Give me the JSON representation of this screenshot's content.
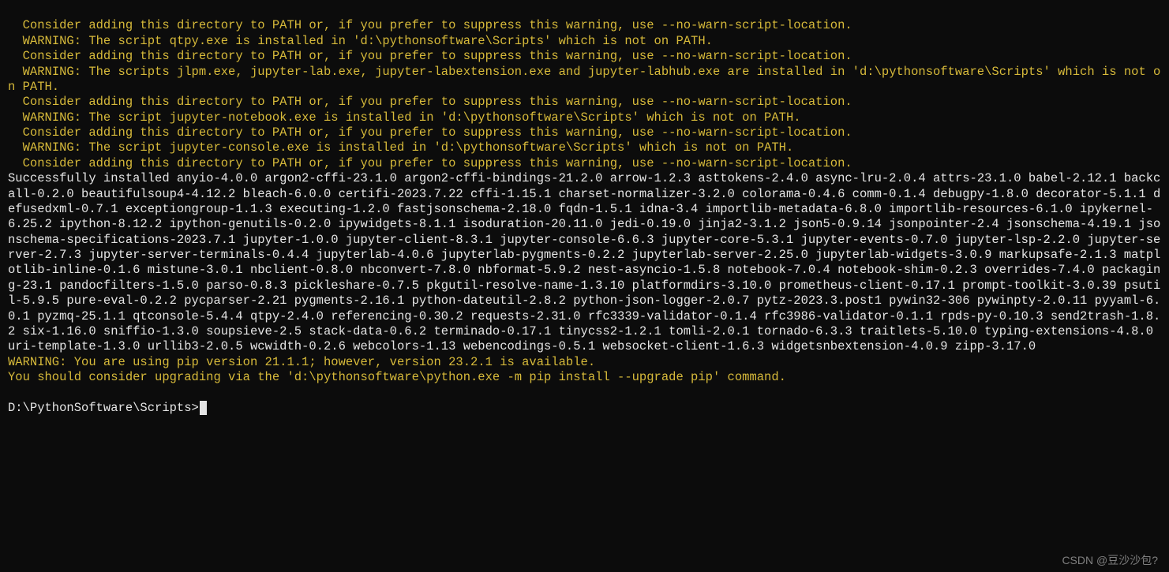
{
  "warnings": {
    "w1": "  Consider adding this directory to PATH or, if you prefer to suppress this warning, use --no-warn-script-location.",
    "w2": "  WARNING: The script qtpy.exe is installed in 'd:\\pythonsoftware\\Scripts' which is not on PATH.",
    "w3": "  Consider adding this directory to PATH or, if you prefer to suppress this warning, use --no-warn-script-location.",
    "w4": "  WARNING: The scripts jlpm.exe, jupyter-lab.exe, jupyter-labextension.exe and jupyter-labhub.exe are installed in 'd:\\pythonsoftware\\Scripts' which is not on PATH.",
    "w5": "  Consider adding this directory to PATH or, if you prefer to suppress this warning, use --no-warn-script-location.",
    "w6": "  WARNING: The script jupyter-notebook.exe is installed in 'd:\\pythonsoftware\\Scripts' which is not on PATH.",
    "w7": "  Consider adding this directory to PATH or, if you prefer to suppress this warning, use --no-warn-script-location.",
    "w8": "  WARNING: The script jupyter-console.exe is installed in 'd:\\pythonsoftware\\Scripts' which is not on PATH.",
    "w9": "  Consider adding this directory to PATH or, if you prefer to suppress this warning, use --no-warn-script-location."
  },
  "installed": "Successfully installed anyio-4.0.0 argon2-cffi-23.1.0 argon2-cffi-bindings-21.2.0 arrow-1.2.3 asttokens-2.4.0 async-lru-2.0.4 attrs-23.1.0 babel-2.12.1 backcall-0.2.0 beautifulsoup4-4.12.2 bleach-6.0.0 certifi-2023.7.22 cffi-1.15.1 charset-normalizer-3.2.0 colorama-0.4.6 comm-0.1.4 debugpy-1.8.0 decorator-5.1.1 defusedxml-0.7.1 exceptiongroup-1.1.3 executing-1.2.0 fastjsonschema-2.18.0 fqdn-1.5.1 idna-3.4 importlib-metadata-6.8.0 importlib-resources-6.1.0 ipykernel-6.25.2 ipython-8.12.2 ipython-genutils-0.2.0 ipywidgets-8.1.1 isoduration-20.11.0 jedi-0.19.0 jinja2-3.1.2 json5-0.9.14 jsonpointer-2.4 jsonschema-4.19.1 jsonschema-specifications-2023.7.1 jupyter-1.0.0 jupyter-client-8.3.1 jupyter-console-6.6.3 jupyter-core-5.3.1 jupyter-events-0.7.0 jupyter-lsp-2.2.0 jupyter-server-2.7.3 jupyter-server-terminals-0.4.4 jupyterlab-4.0.6 jupyterlab-pygments-0.2.2 jupyterlab-server-2.25.0 jupyterlab-widgets-3.0.9 markupsafe-2.1.3 matplotlib-inline-0.1.6 mistune-3.0.1 nbclient-0.8.0 nbconvert-7.8.0 nbformat-5.9.2 nest-asyncio-1.5.8 notebook-7.0.4 notebook-shim-0.2.3 overrides-7.4.0 packaging-23.1 pandocfilters-1.5.0 parso-0.8.3 pickleshare-0.7.5 pkgutil-resolve-name-1.3.10 platformdirs-3.10.0 prometheus-client-0.17.1 prompt-toolkit-3.0.39 psutil-5.9.5 pure-eval-0.2.2 pycparser-2.21 pygments-2.16.1 python-dateutil-2.8.2 python-json-logger-2.0.7 pytz-2023.3.post1 pywin32-306 pywinpty-2.0.11 pyyaml-6.0.1 pyzmq-25.1.1 qtconsole-5.4.4 qtpy-2.4.0 referencing-0.30.2 requests-2.31.0 rfc3339-validator-0.1.4 rfc3986-validator-0.1.1 rpds-py-0.10.3 send2trash-1.8.2 six-1.16.0 sniffio-1.3.0 soupsieve-2.5 stack-data-0.6.2 terminado-0.17.1 tinycss2-1.2.1 tomli-2.0.1 tornado-6.3.3 traitlets-5.10.0 typing-extensions-4.8.0 uri-template-1.3.0 urllib3-2.0.5 wcwidth-0.2.6 webcolors-1.13 webencodings-0.5.1 websocket-client-1.6.3 widgetsnbextension-4.0.9 zipp-3.17.0",
  "pip_warning": {
    "line1": "WARNING: You are using pip version 21.1.1; however, version 23.2.1 is available.",
    "line2": "You should consider upgrading via the 'd:\\pythonsoftware\\python.exe -m pip install --upgrade pip' command."
  },
  "prompt": "D:\\PythonSoftware\\Scripts>",
  "watermark": "CSDN @豆沙沙包?"
}
